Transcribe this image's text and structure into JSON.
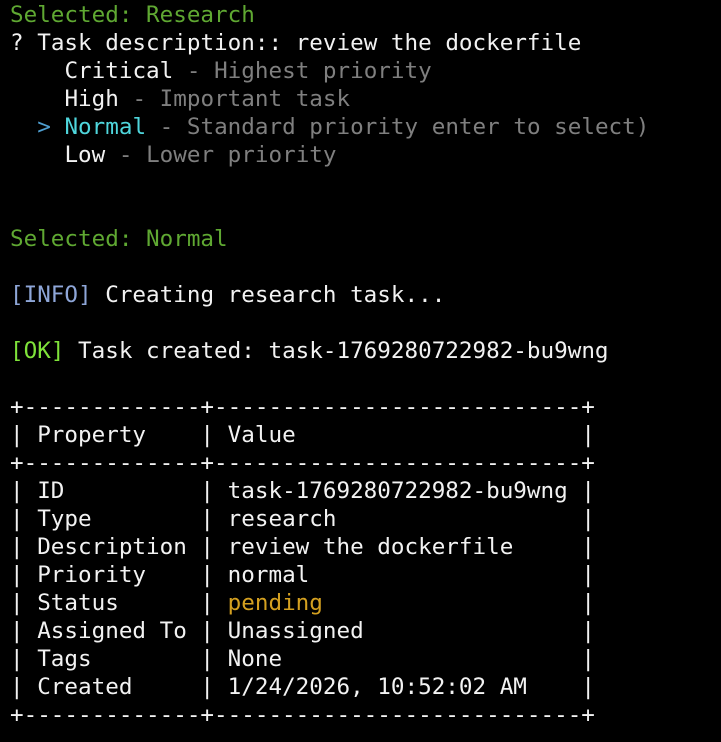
{
  "selected_category": {
    "label": "Selected: Research"
  },
  "prompt": {
    "question_mark": "?",
    "label": "Task description::",
    "answer": "review the dockerfile"
  },
  "priority_options": [
    {
      "cursor": " ",
      "name": "Critical",
      "separator": " - ",
      "description": "Highest priority"
    },
    {
      "cursor": " ",
      "name": "High",
      "separator": " - ",
      "description": "Important task"
    },
    {
      "cursor": ">",
      "name": "Normal",
      "separator": " - ",
      "description": "Standard priority enter to select)"
    },
    {
      "cursor": " ",
      "name": "Low",
      "separator": " - ",
      "description": "Lower priority"
    }
  ],
  "selected_priority": {
    "label": "Selected: Normal"
  },
  "info_message": {
    "tag": "[INFO]",
    "text": " Creating research task..."
  },
  "ok_message": {
    "tag": "[OK]",
    "text": " Task created: task-1769280722982-bu9wng"
  },
  "table": {
    "border": "+-------------+---------------------------+",
    "header": {
      "left": "| Property    | ",
      "value": "Value",
      "right": "                     |"
    },
    "rows": [
      {
        "left": "| ID          | ",
        "value": "task-1769280722982-bu9wng",
        "right": " |"
      },
      {
        "left": "| Type        | ",
        "value": "research",
        "right": "                  |"
      },
      {
        "left": "| Description | ",
        "value": "review the dockerfile",
        "right": "     |"
      },
      {
        "left": "| Priority    | ",
        "value": "normal",
        "right": "                    |"
      },
      {
        "left": "| Status      | ",
        "value": "pending",
        "right": "                   |"
      },
      {
        "left": "| Assigned To | ",
        "value": "Unassigned",
        "right": "                |"
      },
      {
        "left": "| Tags        | ",
        "value": "None",
        "right": "                      |"
      },
      {
        "left": "| Created     | ",
        "value": "1/24/2026, 10:52:02 AM",
        "right": "    |"
      }
    ]
  },
  "colors": {
    "background": "#000000",
    "selected": "#5fa832",
    "ok": "#7fe33a",
    "info": "#8ea6d8",
    "highlight": "#4fd6dc",
    "muted": "#7f7f7f",
    "pending": "#d4a020"
  }
}
